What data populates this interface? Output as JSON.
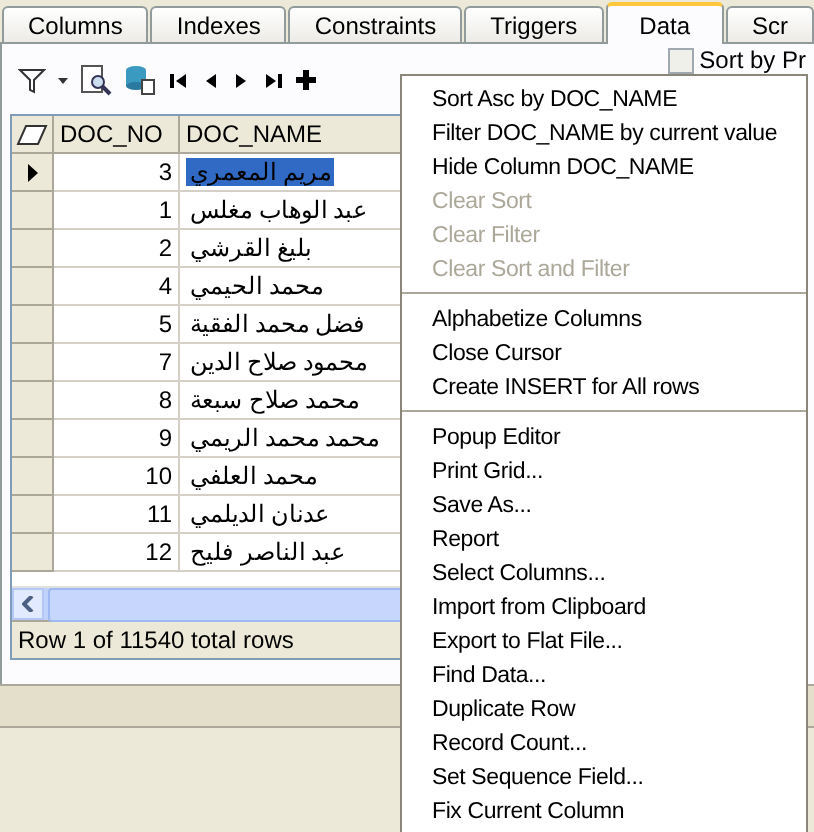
{
  "tabs": [
    {
      "label": "Columns",
      "selected": false
    },
    {
      "label": "Indexes",
      "selected": false
    },
    {
      "label": "Constraints",
      "selected": false
    },
    {
      "label": "Triggers",
      "selected": false
    },
    {
      "label": "Data",
      "selected": true
    },
    {
      "label": "Scr",
      "selected": false
    }
  ],
  "sort_checkbox": {
    "label": "Sort by Pr",
    "checked": false
  },
  "grid": {
    "columns": [
      "DOC_NO",
      "DOC_NAME"
    ],
    "rows": [
      {
        "doc_no": "3",
        "doc_name": "مريم المعمري",
        "selected": true
      },
      {
        "doc_no": "1",
        "doc_name": "عبد الوهاب مغلس",
        "selected": false
      },
      {
        "doc_no": "2",
        "doc_name": "بليغ القرشي",
        "selected": false
      },
      {
        "doc_no": "4",
        "doc_name": "محمد الحيمي",
        "selected": false
      },
      {
        "doc_no": "5",
        "doc_name": "فضل محمد الفقية",
        "selected": false
      },
      {
        "doc_no": "7",
        "doc_name": "محمود صلاح الدين",
        "selected": false
      },
      {
        "doc_no": "8",
        "doc_name": "محمد صلاح سبعة",
        "selected": false
      },
      {
        "doc_no": "9",
        "doc_name": "محمد محمد الريمي",
        "selected": false
      },
      {
        "doc_no": "10",
        "doc_name": "محمد العلفي",
        "selected": false
      },
      {
        "doc_no": "11",
        "doc_name": "عدنان الديلمي",
        "selected": false
      },
      {
        "doc_no": "12",
        "doc_name": "عبد الناصر فليح",
        "selected": false
      }
    ]
  },
  "status_bar": "Row 1 of 11540 total rows",
  "context_menu": [
    {
      "kind": "item",
      "label": "Sort Asc by DOC_NAME",
      "disabled": false
    },
    {
      "kind": "item",
      "label": "Filter DOC_NAME by current value",
      "disabled": false
    },
    {
      "kind": "item",
      "label": "Hide Column DOC_NAME",
      "disabled": false
    },
    {
      "kind": "item",
      "label": "Clear Sort",
      "disabled": true
    },
    {
      "kind": "item",
      "label": "Clear Filter",
      "disabled": true
    },
    {
      "kind": "item",
      "label": "Clear Sort and Filter",
      "disabled": true
    },
    {
      "kind": "separator"
    },
    {
      "kind": "item",
      "label": "Alphabetize Columns",
      "disabled": false
    },
    {
      "kind": "item",
      "label": "Close Cursor",
      "disabled": false
    },
    {
      "kind": "item",
      "label": "Create INSERT for All rows",
      "disabled": false
    },
    {
      "kind": "separator"
    },
    {
      "kind": "item",
      "label": "Popup Editor",
      "disabled": false
    },
    {
      "kind": "item",
      "label": "Print Grid...",
      "disabled": false
    },
    {
      "kind": "item",
      "label": "Save As...",
      "disabled": false
    },
    {
      "kind": "item",
      "label": "Report",
      "disabled": false
    },
    {
      "kind": "item",
      "label": "Select Columns...",
      "disabled": false
    },
    {
      "kind": "item",
      "label": "Import from Clipboard",
      "disabled": false
    },
    {
      "kind": "item",
      "label": "Export to Flat File...",
      "disabled": false
    },
    {
      "kind": "item",
      "label": "Find Data...",
      "disabled": false
    },
    {
      "kind": "item",
      "label": "Duplicate Row",
      "disabled": false
    },
    {
      "kind": "item",
      "label": "Record Count...",
      "disabled": false
    },
    {
      "kind": "item",
      "label": "Set Sequence Field...",
      "disabled": false
    },
    {
      "kind": "item",
      "label": "Fix Current Column",
      "disabled": false
    }
  ]
}
